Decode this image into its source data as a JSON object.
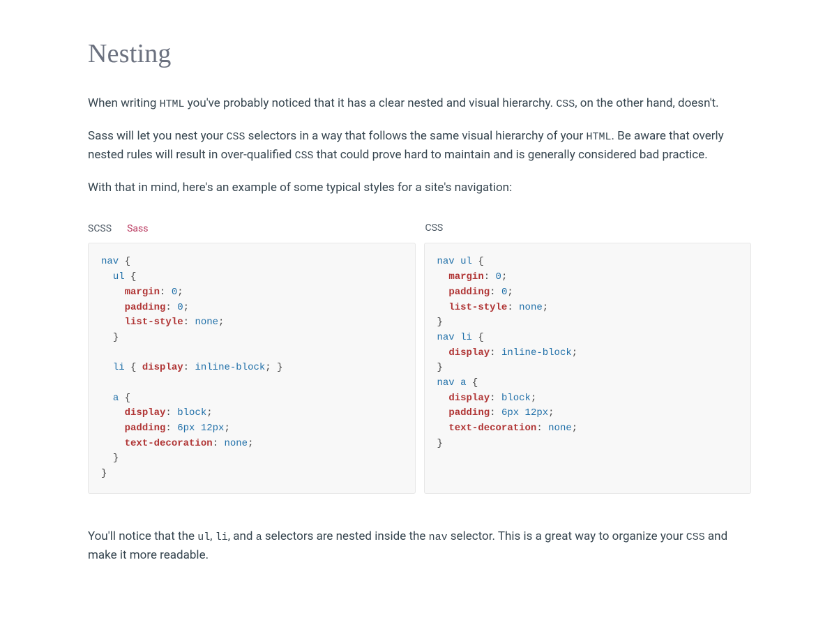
{
  "heading": "Nesting",
  "para1": {
    "t1": "When writing ",
    "c1": "HTML",
    "t2": " you've probably noticed that it has a clear nested and visual hierarchy. ",
    "c2": "CSS",
    "t3": ", on the other hand, doesn't."
  },
  "para2": {
    "t1": "Sass will let you nest your ",
    "c1": "CSS",
    "t2": " selectors in a way that follows the same visual hierarchy of your ",
    "c2": "HTML",
    "t3": ". Be aware that overly nested rules will result in over-qualified ",
    "c3": "CSS",
    "t4": " that could prove hard to maintain and is generally considered bad practice."
  },
  "para3": "With that in mind, here's an example of some typical styles for a site's navigation:",
  "tabs": {
    "scss": "SCSS",
    "sass": "Sass",
    "css": "CSS"
  },
  "scss": {
    "l1_sel": "nav",
    "l1_b": " {",
    "l2_sel": "ul",
    "l2_b": " {",
    "l3_p": "margin",
    "l3_c": ": ",
    "l3_v": "0",
    "l3_s": ";",
    "l4_p": "padding",
    "l4_c": ": ",
    "l4_v": "0",
    "l4_s": ";",
    "l5_p": "list-style",
    "l5_c": ": ",
    "l5_v": "none",
    "l5_s": ";",
    "l6_cb": "}",
    "l7_sel": "li",
    "l7_b": " { ",
    "l7_p": "display",
    "l7_c": ": ",
    "l7_v": "inline-block",
    "l7_s": ";",
    "l7_cb": " }",
    "l8_sel": "a",
    "l8_b": " {",
    "l9_p": "display",
    "l9_c": ": ",
    "l9_v": "block",
    "l9_s": ";",
    "l10_p": "padding",
    "l10_c": ": ",
    "l10_v": "6px 12px",
    "l10_s": ";",
    "l11_p": "text-decoration",
    "l11_c": ": ",
    "l11_v": "none",
    "l11_s": ";",
    "l12_cb": "}",
    "l13_cb": "}"
  },
  "css": {
    "l1_sel": "nav ul",
    "l1_b": " {",
    "l2_p": "margin",
    "l2_c": ": ",
    "l2_v": "0",
    "l2_s": ";",
    "l3_p": "padding",
    "l3_c": ": ",
    "l3_v": "0",
    "l3_s": ";",
    "l4_p": "list-style",
    "l4_c": ": ",
    "l4_v": "none",
    "l4_s": ";",
    "l5_cb": "}",
    "l6_sel": "nav li",
    "l6_b": " {",
    "l7_p": "display",
    "l7_c": ": ",
    "l7_v": "inline-block",
    "l7_s": ";",
    "l8_cb": "}",
    "l9_sel": "nav a",
    "l9_b": " {",
    "l10_p": "display",
    "l10_c": ": ",
    "l10_v": "block",
    "l10_s": ";",
    "l11_p": "padding",
    "l11_c": ": ",
    "l11_v": "6px 12px",
    "l11_s": ";",
    "l12_p": "text-decoration",
    "l12_c": ": ",
    "l12_v": "none",
    "l12_s": ";",
    "l13_cb": "}"
  },
  "para4": {
    "t1": "You'll notice that the ",
    "c1": "ul",
    "t2": ", ",
    "c2": "li",
    "t3": ", and ",
    "c3": "a",
    "t4": " selectors are nested inside the ",
    "c4": "nav",
    "t5": " selector. This is a great way to organize your ",
    "c5": "CSS",
    "t6": " and make it more readable."
  }
}
